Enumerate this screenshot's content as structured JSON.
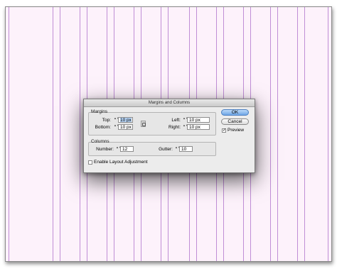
{
  "dialog": {
    "title": "Margins and Columns",
    "margins": {
      "group_label": "Margins",
      "top_label": "Top:",
      "top_value": "10 px",
      "bottom_label": "Bottom:",
      "bottom_value": "10 px",
      "left_label": "Left:",
      "left_value": "10 px",
      "right_label": "Right:",
      "right_value": "10 px"
    },
    "columns": {
      "group_label": "Columns",
      "number_label": "Number:",
      "number_value": "12",
      "gutter_label": "Gutter:",
      "gutter_value": "10 px"
    },
    "enable_layout_adjustment": {
      "label": "Enable Layout Adjustment",
      "checked": false
    },
    "ok_label": "OK",
    "cancel_label": "Cancel",
    "preview": {
      "label": "Preview",
      "checked": true,
      "check_glyph": "✓"
    },
    "stepper_glyph": "▲▼"
  },
  "colors": {
    "guide": "#c08ed6",
    "page": "#fdf2fb",
    "default_button": "#6ea6e6"
  }
}
